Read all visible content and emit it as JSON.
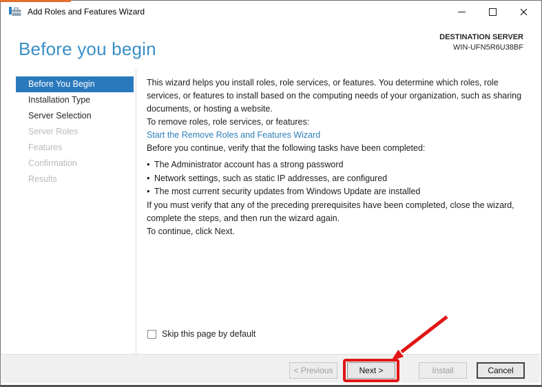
{
  "window": {
    "title": "Add Roles and Features Wizard"
  },
  "header": {
    "title": "Before you begin",
    "destination_label": "DESTINATION SERVER",
    "destination_server": "WIN-UFN5R6U38BF"
  },
  "sidebar": {
    "items": [
      {
        "label": "Before You Begin",
        "state": "selected"
      },
      {
        "label": "Installation Type",
        "state": "enabled"
      },
      {
        "label": "Server Selection",
        "state": "enabled"
      },
      {
        "label": "Server Roles",
        "state": "disabled"
      },
      {
        "label": "Features",
        "state": "disabled"
      },
      {
        "label": "Confirmation",
        "state": "disabled"
      },
      {
        "label": "Results",
        "state": "disabled"
      }
    ]
  },
  "content": {
    "intro": "This wizard helps you install roles, role services, or features. You determine which roles, role services, or features to install based on the computing needs of your organization, such as sharing documents, or hosting a website.",
    "remove_heading": "To remove roles, role services, or features:",
    "remove_link": "Start the Remove Roles and Features Wizard",
    "verify_heading": "Before you continue, verify that the following tasks have been completed:",
    "tasks": [
      "The Administrator account has a strong password",
      "Network settings, such as static IP addresses, are configured",
      "The most current security updates from Windows Update are installed"
    ],
    "note": "If you must verify that any of the preceding prerequisites have been completed, close the wizard, complete the steps, and then run the wizard again.",
    "continue_text": "To continue, click Next.",
    "skip_checkbox_label": "Skip this page by default",
    "skip_checkbox_checked": false
  },
  "footer": {
    "previous_label": "< Previous",
    "next_label": "Next >",
    "install_label": "Install",
    "cancel_label": "Cancel",
    "previous_state": "disabled",
    "next_state": "enabled",
    "install_state": "disabled",
    "cancel_state": "enabled"
  },
  "annotation": {
    "color": "#e01515",
    "target": "Next button",
    "shapes": [
      "arrow",
      "rectangle"
    ]
  },
  "colors": {
    "header_title_blue": "#3a8fc7",
    "selected_nav_blue": "#2b79bd",
    "link_blue": "#2d7eb8",
    "annotation_red": "#e01515",
    "footer_gray": "#f0f0f0",
    "top_artifact_orange": "#e2702b"
  }
}
